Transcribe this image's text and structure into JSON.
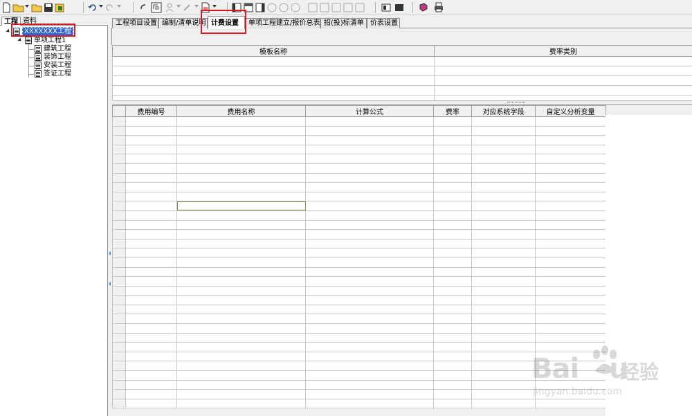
{
  "left_panel": {
    "tabs": [
      {
        "label": "工程"
      },
      {
        "label": "资料"
      }
    ],
    "tree": {
      "root": "XXXXXXX工程",
      "child": "单项工程1",
      "leaves": [
        "建筑工程",
        "装饰工程",
        "安装工程",
        "签证工程"
      ]
    }
  },
  "tabs": [
    {
      "label": "工程项目设置"
    },
    {
      "label": "编制/清单说明"
    },
    {
      "label": "计费设置"
    },
    {
      "label": "单项工程建立/报价总表"
    },
    {
      "label": "招(投)标清单"
    },
    {
      "label": "价表设置"
    }
  ],
  "active_tab": "计费设置",
  "template_table": {
    "headers": [
      "模板名称",
      "费率类别"
    ]
  },
  "fee_table": {
    "headers": [
      "费用编号",
      "费用名称",
      "计算公式",
      "费率",
      "对应系统字段",
      "自定义分析变量"
    ]
  },
  "watermark": {
    "brand": "Bai",
    "brand_suffix": "u",
    "brand_cn": "经验",
    "url": "jingyan.baidu.com"
  },
  "colors": {
    "highlight_box": "#d9191f",
    "selection": "#3366cc",
    "cell_selected": "#7a8c47"
  }
}
